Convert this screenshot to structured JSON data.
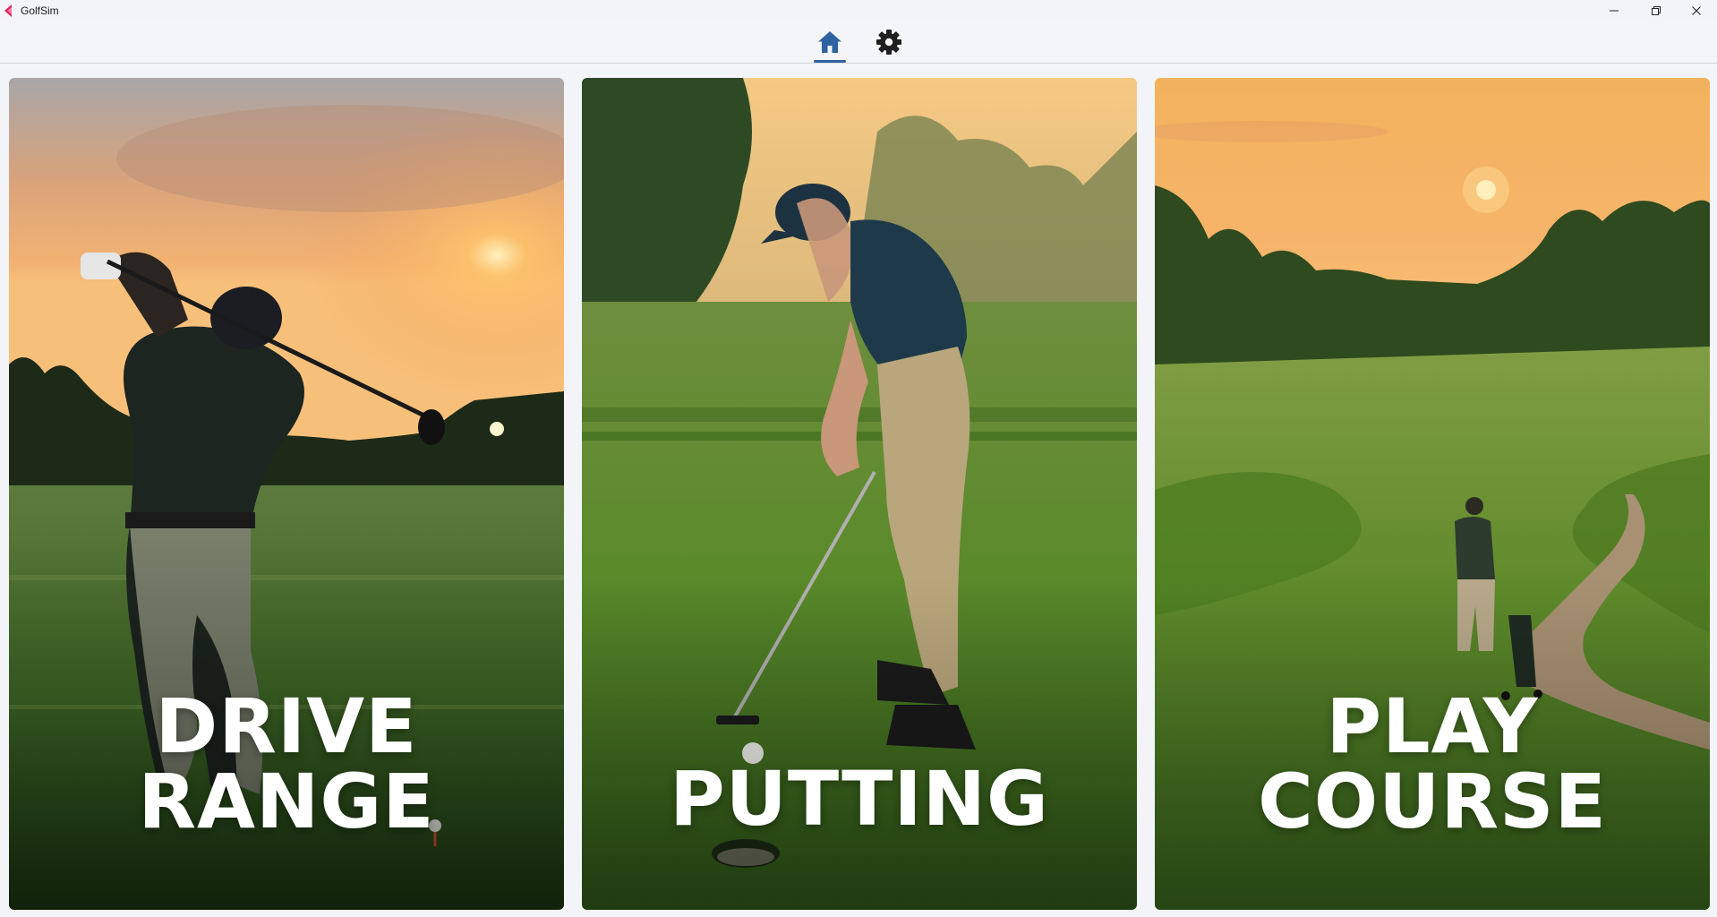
{
  "window": {
    "title": "GolfSim",
    "controls": [
      "minimize-icon",
      "maximize-icon",
      "close-icon"
    ]
  },
  "nav": {
    "items": [
      {
        "icon": "home-icon",
        "active": true
      },
      {
        "icon": "gear-icon",
        "active": false
      }
    ],
    "accent": "#2f62a1"
  },
  "cards": [
    {
      "lines": [
        "DRIVE",
        "RANGE"
      ]
    },
    {
      "lines": [
        "PUTTING"
      ]
    },
    {
      "lines": [
        "PLAY",
        "COURSE"
      ]
    }
  ]
}
